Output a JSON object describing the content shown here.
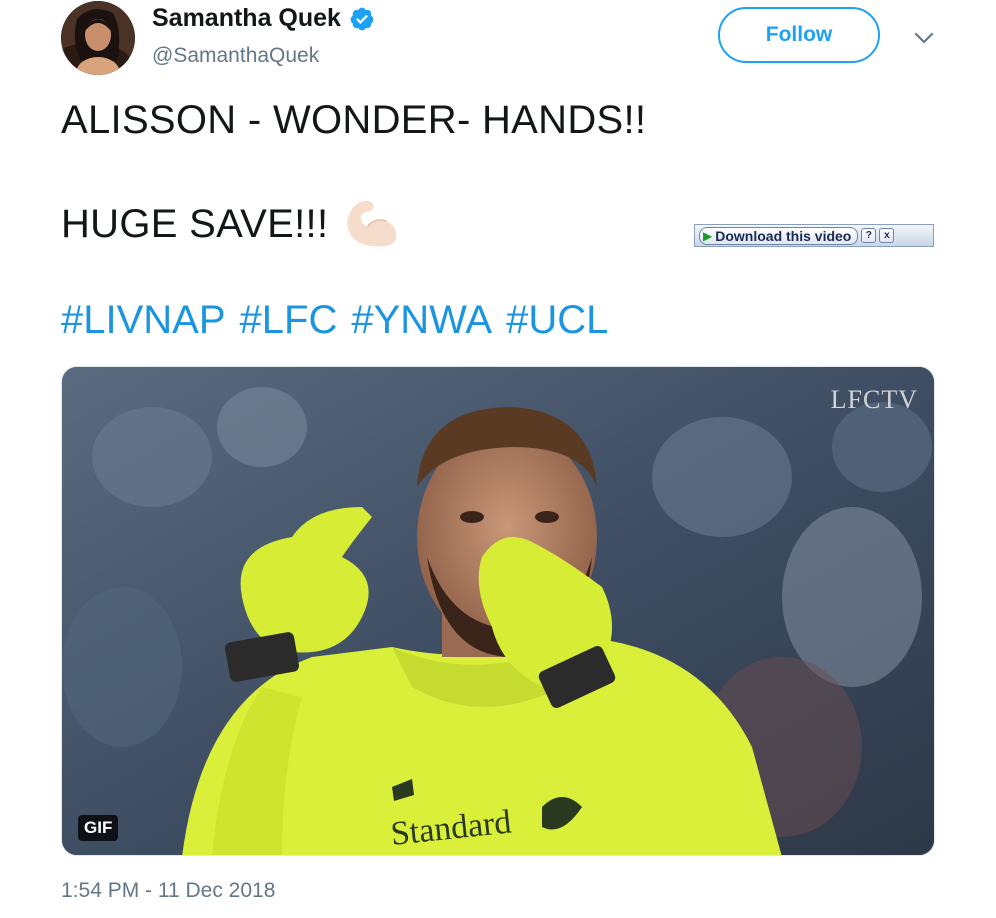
{
  "author": {
    "display_name": "Samantha Quek",
    "handle": "@SamanthaQuek",
    "verified": true
  },
  "follow_button": {
    "label": "Follow"
  },
  "menu": {
    "icon": "chevron-down-icon"
  },
  "tweet": {
    "line1": "ALISSON - WONDER- HANDS!!",
    "line2": "HUGE SAVE!!!",
    "emoji": "flexed-biceps",
    "hashtags": [
      "#LIVNAP",
      "#LFC",
      "#YNWA",
      "#UCL"
    ]
  },
  "download_bar": {
    "label": "Download this video",
    "help": "?",
    "close": "x"
  },
  "media": {
    "watermark": "LFCTV",
    "badge": "GIF",
    "shirt_text": "Standard"
  },
  "timestamp": "1:54 PM - 11 Dec 2018",
  "colors": {
    "accent": "#1da1f2",
    "hashtag": "#1b95e0",
    "muted": "#657786",
    "kit": "#d9ef3a"
  }
}
